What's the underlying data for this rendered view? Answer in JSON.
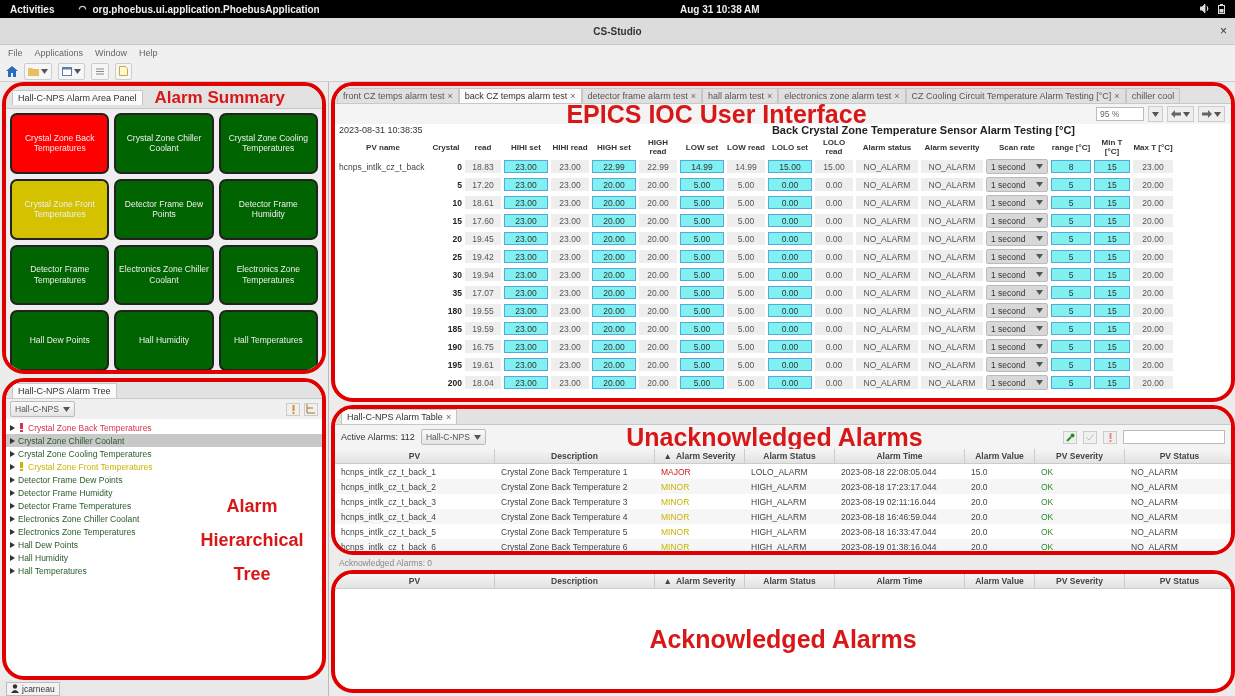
{
  "top_bar": {
    "activities": "Activities",
    "app_name": "org.phoebus.ui.application.PhoebusApplication",
    "clock": "Aug 31 10:38 AM"
  },
  "window": {
    "title": "CS-Studio",
    "close": "×"
  },
  "menu": [
    "File",
    "Applications",
    "Window",
    "Help"
  ],
  "area_panel": {
    "tab": "Hall-C-NPS Alarm Area Panel",
    "annotation": "Alarm Summary",
    "tiles": [
      {
        "label": "Crystal Zone Back Temperatures",
        "color": "#ff0000"
      },
      {
        "label": "Crystal Zone Chiller Coolant",
        "color": "#006400"
      },
      {
        "label": "Crystal Zone Cooling Temperatures",
        "color": "#006400"
      },
      {
        "label": "Crystal Zone Front Temperatures",
        "color": "#d4c200"
      },
      {
        "label": "Detector Frame Dew Points",
        "color": "#006400"
      },
      {
        "label": "Detector Frame Humidity",
        "color": "#006400"
      },
      {
        "label": "Detector Frame Temperatures",
        "color": "#006400"
      },
      {
        "label": "Electronics Zone Chiller Coolant",
        "color": "#006400"
      },
      {
        "label": "Electronics Zone Temperatures",
        "color": "#006400"
      },
      {
        "label": "Hall Dew Points",
        "color": "#006400"
      },
      {
        "label": "Hall Humidity",
        "color": "#006400"
      },
      {
        "label": "Hall Temperatures",
        "color": "#006400"
      }
    ]
  },
  "alarm_tree": {
    "tab": "Hall-C-NPS Alarm Tree",
    "config": "Hall-C-NPS",
    "annotation": "Alarm Hierarchical Tree",
    "items": [
      {
        "label": "Crystal Zone Back Temperatures",
        "kind": "major",
        "selected": false
      },
      {
        "label": "Crystal Zone Chiller Coolant",
        "kind": "ok",
        "selected": true
      },
      {
        "label": "Crystal Zone Cooling Temperatures",
        "kind": "ok",
        "selected": false
      },
      {
        "label": "Crystal Zone Front Temperatures",
        "kind": "minor",
        "selected": false
      },
      {
        "label": "Detector Frame Dew Points",
        "kind": "ok",
        "selected": false
      },
      {
        "label": "Detector Frame Humidity",
        "kind": "ok",
        "selected": false
      },
      {
        "label": "Detector Frame Temperatures",
        "kind": "ok",
        "selected": false
      },
      {
        "label": "Electronics Zone Chiller Coolant",
        "kind": "ok",
        "selected": false
      },
      {
        "label": "Electronics Zone Temperatures",
        "kind": "ok",
        "selected": false
      },
      {
        "label": "Hall Dew Points",
        "kind": "ok",
        "selected": false
      },
      {
        "label": "Hall Humidity",
        "kind": "ok",
        "selected": false
      },
      {
        "label": "Hall Temperatures",
        "kind": "ok",
        "selected": false
      }
    ]
  },
  "status_user": "jcarneau",
  "display": {
    "annotation": "EPICS IOC User Interface",
    "zoom": "95 %",
    "tabs": [
      {
        "label": "front CZ temps alarm test",
        "close": "×",
        "selected": false
      },
      {
        "label": "back CZ temps alarm test",
        "close": "×",
        "selected": true
      },
      {
        "label": "detector frame alarm test",
        "close": "×",
        "selected": false
      },
      {
        "label": "hall alarm test",
        "close": "×",
        "selected": false
      },
      {
        "label": "electronics zone alarm test",
        "close": "×",
        "selected": false
      },
      {
        "label": "CZ Cooling Circuit Temperature Alarm Testing  [°C]",
        "close": "×",
        "selected": false
      },
      {
        "label": "chiller cool",
        "selected": false
      }
    ],
    "timestamp": "2023-08-31 10:38:35",
    "title": "Back Crystal Zone Temperature Sensor Alarm Testing  [°C]",
    "columns": [
      {
        "label": "PV name",
        "kind": "name"
      },
      {
        "label": "Crystal",
        "kind": "index"
      },
      {
        "label": "read",
        "kind": "read"
      },
      {
        "label": "HIHI set",
        "kind": "set"
      },
      {
        "label": "HIHI read",
        "kind": "read"
      },
      {
        "label": "HIGH set",
        "kind": "set"
      },
      {
        "label": "HIGH read",
        "kind": "read"
      },
      {
        "label": "LOW set",
        "kind": "set"
      },
      {
        "label": "LOW read",
        "kind": "read"
      },
      {
        "label": "LOLO set",
        "kind": "set"
      },
      {
        "label": "LOLO read",
        "kind": "read"
      },
      {
        "label": "Alarm status",
        "kind": "read"
      },
      {
        "label": "Alarm severity",
        "kind": "read"
      },
      {
        "label": "Scan rate",
        "kind": "combo"
      },
      {
        "label": "range [°C]",
        "kind": "set"
      },
      {
        "label": "Min T [°C]",
        "kind": "set"
      },
      {
        "label": "Max T [°C]",
        "kind": "read"
      }
    ],
    "rows": [
      [
        "hcnps_intlk_cz_t_back",
        "0",
        "18.83",
        "23.00",
        "23.00",
        "22.99",
        "22.99",
        "14.99",
        "14.99",
        "15.00",
        "15.00",
        "NO_ALARM",
        "NO_ALARM",
        "1 second",
        "8",
        "15",
        "23.00"
      ],
      [
        "",
        "5",
        "17.20",
        "23.00",
        "23.00",
        "20.00",
        "20.00",
        "5.00",
        "5.00",
        "0.00",
        "0.00",
        "NO_ALARM",
        "NO_ALARM",
        "1 second",
        "5",
        "15",
        "20.00"
      ],
      [
        "",
        "10",
        "18.61",
        "23.00",
        "23.00",
        "20.00",
        "20.00",
        "5.00",
        "5.00",
        "0.00",
        "0.00",
        "NO_ALARM",
        "NO_ALARM",
        "1 second",
        "5",
        "15",
        "20.00"
      ],
      [
        "",
        "15",
        "17.60",
        "23.00",
        "23.00",
        "20.00",
        "20.00",
        "5.00",
        "5.00",
        "0.00",
        "0.00",
        "NO_ALARM",
        "NO_ALARM",
        "1 second",
        "5",
        "15",
        "20.00"
      ],
      [
        "",
        "20",
        "19.45",
        "23.00",
        "23.00",
        "20.00",
        "20.00",
        "5.00",
        "5.00",
        "0.00",
        "0.00",
        "NO_ALARM",
        "NO_ALARM",
        "1 second",
        "5",
        "15",
        "20.00"
      ],
      [
        "",
        "25",
        "19.42",
        "23.00",
        "23.00",
        "20.00",
        "20.00",
        "5.00",
        "5.00",
        "0.00",
        "0.00",
        "NO_ALARM",
        "NO_ALARM",
        "1 second",
        "5",
        "15",
        "20.00"
      ],
      [
        "",
        "30",
        "19.94",
        "23.00",
        "23.00",
        "20.00",
        "20.00",
        "5.00",
        "5.00",
        "0.00",
        "0.00",
        "NO_ALARM",
        "NO_ALARM",
        "1 second",
        "5",
        "15",
        "20.00"
      ],
      [
        "",
        "35",
        "17.07",
        "23.00",
        "23.00",
        "20.00",
        "20.00",
        "5.00",
        "5.00",
        "0.00",
        "0.00",
        "NO_ALARM",
        "NO_ALARM",
        "1 second",
        "5",
        "15",
        "20.00"
      ],
      [
        "",
        "180",
        "19.55",
        "23.00",
        "23.00",
        "20.00",
        "20.00",
        "5.00",
        "5.00",
        "0.00",
        "0.00",
        "NO_ALARM",
        "NO_ALARM",
        "1 second",
        "5",
        "15",
        "20.00"
      ],
      [
        "",
        "185",
        "19.59",
        "23.00",
        "23.00",
        "20.00",
        "20.00",
        "5.00",
        "5.00",
        "0.00",
        "0.00",
        "NO_ALARM",
        "NO_ALARM",
        "1 second",
        "5",
        "15",
        "20.00"
      ],
      [
        "",
        "190",
        "16.75",
        "23.00",
        "23.00",
        "20.00",
        "20.00",
        "5.00",
        "5.00",
        "0.00",
        "0.00",
        "NO_ALARM",
        "NO_ALARM",
        "1 second",
        "5",
        "15",
        "20.00"
      ],
      [
        "",
        "195",
        "19.61",
        "23.00",
        "23.00",
        "20.00",
        "20.00",
        "5.00",
        "5.00",
        "0.00",
        "0.00",
        "NO_ALARM",
        "NO_ALARM",
        "1 second",
        "5",
        "15",
        "20.00"
      ],
      [
        "",
        "200",
        "18.04",
        "23.00",
        "23.00",
        "20.00",
        "20.00",
        "5.00",
        "5.00",
        "0.00",
        "0.00",
        "NO_ALARM",
        "NO_ALARM",
        "1 second",
        "5",
        "15",
        "20.00"
      ]
    ]
  },
  "alarm_table": {
    "tab": "Hall-C-NPS Alarm Table",
    "close": "×",
    "active_count": "Active Alarms: 112",
    "config": "Hall-C-NPS",
    "annotation": "Unacknowledged Alarms",
    "columns": [
      "PV",
      "Description",
      "Alarm Severity",
      "Alarm Status",
      "Alarm Time",
      "Alarm Value",
      "PV Severity",
      "PV Status"
    ],
    "sort_mark": "▲",
    "rows": [
      {
        "pv": "hcnps_intlk_cz_t_back_1",
        "description": "Crystal Zone Back Temperature 1",
        "severity": {
          "text": "MAJOR",
          "kind": "major"
        },
        "status": "LOLO_ALARM",
        "time": "2023-08-18 22:08:05.044",
        "value": "15.0",
        "pv_severity": {
          "text": "OK",
          "kind": "ok"
        },
        "pv_status": "NO_ALARM"
      },
      {
        "pv": "hcnps_intlk_cz_t_back_2",
        "description": "Crystal Zone Back Temperature 2",
        "severity": {
          "text": "MINOR",
          "kind": "minor"
        },
        "status": "HIGH_ALARM",
        "time": "2023-08-18 17:23:17.044",
        "value": "20.0",
        "pv_severity": {
          "text": "OK",
          "kind": "ok"
        },
        "pv_status": "NO_ALARM"
      },
      {
        "pv": "hcnps_intlk_cz_t_back_3",
        "description": "Crystal Zone Back Temperature 3",
        "severity": {
          "text": "MINOR",
          "kind": "minor"
        },
        "status": "HIGH_ALARM",
        "time": "2023-08-19 02:11:16.044",
        "value": "20.0",
        "pv_severity": {
          "text": "OK",
          "kind": "ok"
        },
        "pv_status": "NO_ALARM"
      },
      {
        "pv": "hcnps_intlk_cz_t_back_4",
        "description": "Crystal Zone Back Temperature 4",
        "severity": {
          "text": "MINOR",
          "kind": "minor"
        },
        "status": "HIGH_ALARM",
        "time": "2023-08-18 16:46:59.044",
        "value": "20.0",
        "pv_severity": {
          "text": "OK",
          "kind": "ok"
        },
        "pv_status": "NO_ALARM"
      },
      {
        "pv": "hcnps_intlk_cz_t_back_5",
        "description": "Crystal Zone Back Temperature 5",
        "severity": {
          "text": "MINOR",
          "kind": "minor"
        },
        "status": "HIGH_ALARM",
        "time": "2023-08-18 16:33:47.044",
        "value": "20.0",
        "pv_severity": {
          "text": "OK",
          "kind": "ok"
        },
        "pv_status": "NO_ALARM"
      },
      {
        "pv": "hcnps_intlk_cz_t_back_6",
        "description": "Crystal Zone Back Temperature 6",
        "severity": {
          "text": "MINOR",
          "kind": "minor"
        },
        "status": "HIGH_ALARM",
        "time": "2023-08-19 01:38:16.044",
        "value": "20.0",
        "pv_severity": {
          "text": "OK",
          "kind": "ok"
        },
        "pv_status": "NO_ALARM"
      }
    ]
  },
  "acked_table": {
    "count": "Acknowledged Alarms: 0",
    "annotation": "Acknowledged Alarms",
    "columns": [
      "PV",
      "Description",
      "Alarm Severity",
      "Alarm Status",
      "Alarm Time",
      "Alarm Value",
      "PV Severity",
      "PV Status"
    ],
    "sort_mark": "▲"
  }
}
